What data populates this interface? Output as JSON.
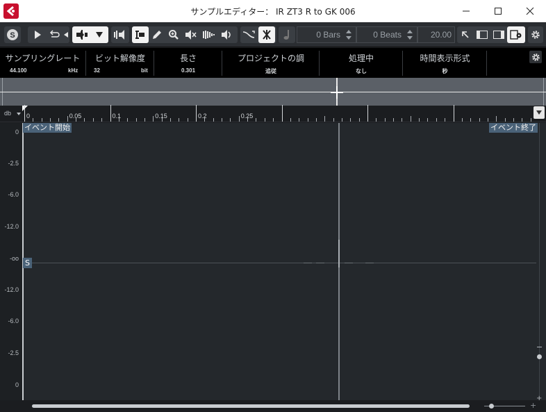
{
  "window": {
    "title": "サンプルエディター： IR ZT3 R to GK 006"
  },
  "toolbar": {
    "bars": "0 Bars",
    "beats": "0 Beats",
    "tempo": "20.00",
    "icons": [
      "solo-icon",
      "play-icon",
      "loop-icon",
      "audition-volume-icon",
      "select-range-icon",
      "pencil-icon",
      "zoom-icon",
      "mute-icon",
      "draw-icon",
      "play-tool-icon",
      "snap-zero-crossing-icon",
      "auto-scroll-icon",
      "musical-mode-icon",
      "window-layout-icon",
      "settings-icon"
    ]
  },
  "infoline": {
    "columns": [
      {
        "label": "サンプリングレート",
        "value": "44.100",
        "unit": "kHz"
      },
      {
        "label": "ビット解像度",
        "value": "32",
        "unit": "bit"
      },
      {
        "label": "長さ",
        "value": "0.301"
      },
      {
        "label": "プロジェクトの調",
        "value": "追従"
      },
      {
        "label": "処理中",
        "value": "なし"
      },
      {
        "label": "時間表示形式",
        "value": "秒"
      }
    ]
  },
  "ruler": {
    "db_label": "db",
    "ticks": [
      "0",
      "0.05",
      "0.1",
      "0.15",
      "0.2",
      "0.25"
    ]
  },
  "waveform": {
    "event_start": "イベント開始",
    "event_end": "イベント終了",
    "sustain_marker": "S",
    "db_scale": [
      "0",
      "-2.5",
      "-6.0",
      "-12.0",
      "-oo",
      "-12.0",
      "-6.0",
      "-2.5",
      "0"
    ]
  },
  "colors": {
    "background": "#24282c",
    "marker": "#4a6278",
    "titlebar": "#ffffff",
    "logo": "#c8102e"
  }
}
